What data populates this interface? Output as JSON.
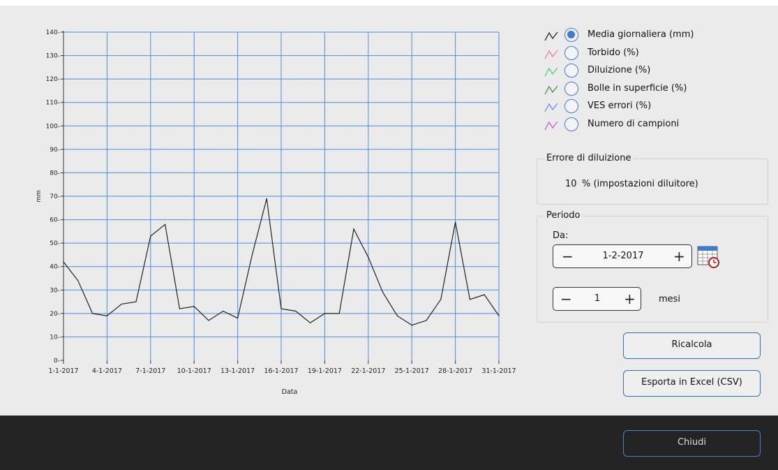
{
  "chart_data": {
    "type": "line",
    "xlabel": "Data",
    "ylabel": "mm",
    "ylim": [
      0,
      140
    ],
    "yticks": [
      0,
      10,
      20,
      30,
      40,
      50,
      60,
      70,
      80,
      90,
      100,
      110,
      120,
      130,
      140
    ],
    "xtick_labels": [
      "1-1-2017",
      "4-1-2017",
      "7-1-2017",
      "10-1-2017",
      "13-1-2017",
      "16-1-2017",
      "19-1-2017",
      "22-1-2017",
      "25-1-2017",
      "28-1-2017",
      "31-1-2017"
    ],
    "x": [
      "1-1-2017",
      "2-1-2017",
      "3-1-2017",
      "4-1-2017",
      "5-1-2017",
      "6-1-2017",
      "7-1-2017",
      "8-1-2017",
      "9-1-2017",
      "10-1-2017",
      "11-1-2017",
      "12-1-2017",
      "13-1-2017",
      "14-1-2017",
      "15-1-2017",
      "16-1-2017",
      "17-1-2017",
      "18-1-2017",
      "19-1-2017",
      "20-1-2017",
      "21-1-2017",
      "22-1-2017",
      "23-1-2017",
      "24-1-2017",
      "25-1-2017",
      "26-1-2017",
      "27-1-2017",
      "28-1-2017",
      "29-1-2017",
      "30-1-2017",
      "31-1-2017"
    ],
    "series": [
      {
        "name": "Media giornaliera (mm)",
        "color": "#222222",
        "values": [
          42,
          34,
          20,
          19,
          24,
          25,
          53,
          58,
          22,
          23,
          17,
          21,
          18,
          45,
          69,
          22,
          21,
          16,
          20,
          20,
          56,
          44,
          29,
          19,
          15,
          17,
          26,
          59,
          26,
          28,
          19
        ]
      }
    ],
    "grid": true,
    "grid_color": "#4a8fe0"
  },
  "legend": {
    "items": [
      {
        "label": "Media giornaliera (mm)",
        "color": "#222222",
        "checked": true
      },
      {
        "label": "Torbido (%)",
        "color": "#f07c8c",
        "checked": false
      },
      {
        "label": "Diluizione (%)",
        "color": "#4fd46a",
        "checked": false
      },
      {
        "label": "Bolle in superficie (%)",
        "color": "#4f8a4f",
        "checked": false
      },
      {
        "label": "VES errori (%)",
        "color": "#6b8ff0",
        "checked": false
      },
      {
        "label": "Numero di campioni",
        "color": "#c25ec9",
        "checked": false
      }
    ]
  },
  "dilution": {
    "title": "Errore di diluizione",
    "value": "10",
    "unit": "% (impostazioni diluitore)"
  },
  "period": {
    "title": "Periodo",
    "from_label": "Da:",
    "from_value": "1-2-2017",
    "months_value": "1",
    "months_unit": "mesi"
  },
  "buttons": {
    "recalc": "Ricalcola",
    "export": "Esporta in Excel (CSV)",
    "close": "Chiudi"
  },
  "spin": {
    "minus": "−",
    "plus": "+"
  }
}
